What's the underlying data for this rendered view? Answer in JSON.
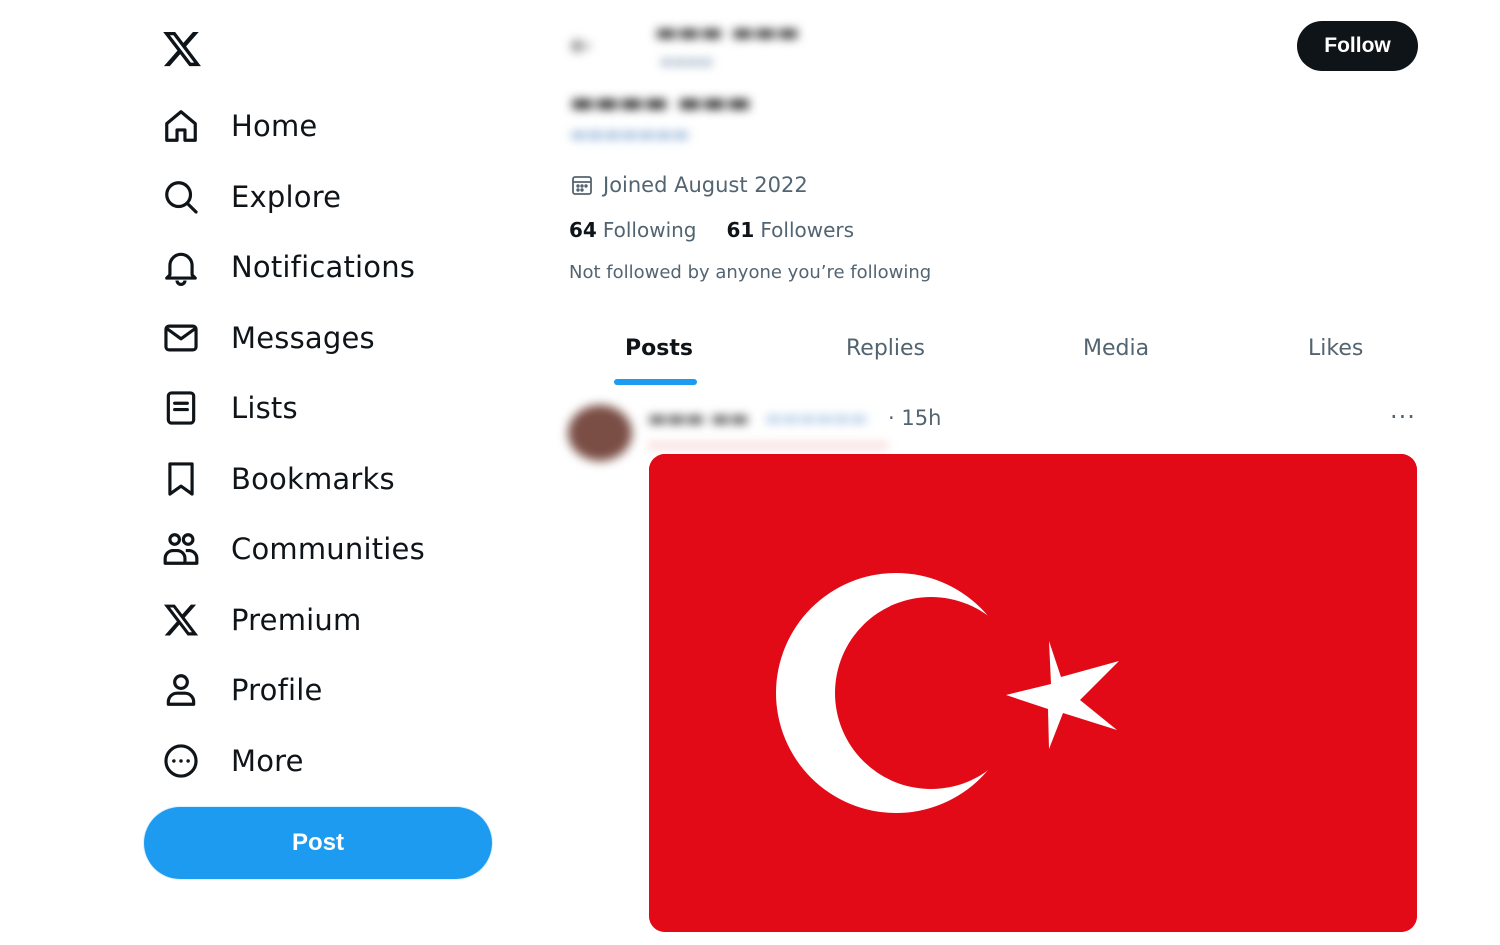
{
  "sidebar": {
    "logo_icon": "x-logo-icon",
    "items": [
      {
        "label": "Home",
        "icon": "home-icon"
      },
      {
        "label": "Explore",
        "icon": "search-icon"
      },
      {
        "label": "Notifications",
        "icon": "bell-icon"
      },
      {
        "label": "Messages",
        "icon": "envelope-icon"
      },
      {
        "label": "Lists",
        "icon": "list-icon"
      },
      {
        "label": "Bookmarks",
        "icon": "bookmark-icon"
      },
      {
        "label": "Communities",
        "icon": "people-icon"
      },
      {
        "label": "Premium",
        "icon": "x-logo-icon"
      },
      {
        "label": "Profile",
        "icon": "person-icon"
      },
      {
        "label": "More",
        "icon": "more-circle-icon"
      }
    ],
    "post_label": "Post"
  },
  "header": {
    "follow_label": "Follow"
  },
  "profile": {
    "joined": "Joined August 2022",
    "following_count": "64",
    "following_label": "Following",
    "followers_count": "61",
    "followers_label": "Followers",
    "not_followed": "Not followed by anyone you’re following"
  },
  "tabs": [
    {
      "label": "Posts",
      "active": true
    },
    {
      "label": "Replies",
      "active": false
    },
    {
      "label": "Media",
      "active": false
    },
    {
      "label": "Likes",
      "active": false
    }
  ],
  "post": {
    "time": "· 15h",
    "more": "···",
    "image_subject": "flag of Turkey",
    "image_colors": {
      "red": "#e30a17",
      "white": "#ffffff"
    }
  },
  "colors": {
    "accent": "#1d9bf0",
    "text_primary": "#0f1419",
    "text_secondary": "#536471"
  }
}
